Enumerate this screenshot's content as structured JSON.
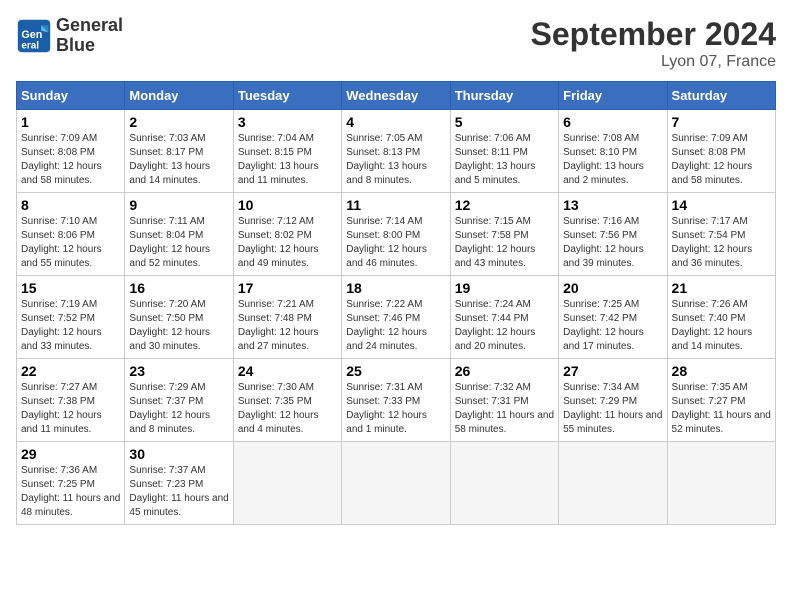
{
  "header": {
    "logo_text_line1": "General",
    "logo_text_line2": "Blue",
    "month_title": "September 2024",
    "location": "Lyon 07, France"
  },
  "weekdays": [
    "Sunday",
    "Monday",
    "Tuesday",
    "Wednesday",
    "Thursday",
    "Friday",
    "Saturday"
  ],
  "days": [
    {
      "num": "",
      "empty": true
    },
    {
      "num": "",
      "empty": true
    },
    {
      "num": "",
      "empty": true
    },
    {
      "num": "",
      "empty": true
    },
    {
      "num": "",
      "empty": true
    },
    {
      "num": "",
      "empty": true
    },
    {
      "num": "1",
      "sunrise": "7:09 AM",
      "sunset": "8:08 PM",
      "daylight": "12 hours and 58 minutes."
    },
    {
      "num": "2",
      "sunrise": "7:03 AM",
      "sunset": "8:17 PM",
      "daylight": "13 hours and 14 minutes."
    },
    {
      "num": "3",
      "sunrise": "7:04 AM",
      "sunset": "8:15 PM",
      "daylight": "13 hours and 11 minutes."
    },
    {
      "num": "4",
      "sunrise": "7:05 AM",
      "sunset": "8:13 PM",
      "daylight": "13 hours and 8 minutes."
    },
    {
      "num": "5",
      "sunrise": "7:06 AM",
      "sunset": "8:11 PM",
      "daylight": "13 hours and 5 minutes."
    },
    {
      "num": "6",
      "sunrise": "7:08 AM",
      "sunset": "8:10 PM",
      "daylight": "13 hours and 2 minutes."
    },
    {
      "num": "7",
      "sunrise": "7:09 AM",
      "sunset": "8:08 PM",
      "daylight": "12 hours and 58 minutes."
    },
    {
      "num": "8",
      "sunrise": "7:10 AM",
      "sunset": "8:06 PM",
      "daylight": "12 hours and 55 minutes."
    },
    {
      "num": "9",
      "sunrise": "7:11 AM",
      "sunset": "8:04 PM",
      "daylight": "12 hours and 52 minutes."
    },
    {
      "num": "10",
      "sunrise": "7:12 AM",
      "sunset": "8:02 PM",
      "daylight": "12 hours and 49 minutes."
    },
    {
      "num": "11",
      "sunrise": "7:14 AM",
      "sunset": "8:00 PM",
      "daylight": "12 hours and 46 minutes."
    },
    {
      "num": "12",
      "sunrise": "7:15 AM",
      "sunset": "7:58 PM",
      "daylight": "12 hours and 43 minutes."
    },
    {
      "num": "13",
      "sunrise": "7:16 AM",
      "sunset": "7:56 PM",
      "daylight": "12 hours and 39 minutes."
    },
    {
      "num": "14",
      "sunrise": "7:17 AM",
      "sunset": "7:54 PM",
      "daylight": "12 hours and 36 minutes."
    },
    {
      "num": "15",
      "sunrise": "7:19 AM",
      "sunset": "7:52 PM",
      "daylight": "12 hours and 33 minutes."
    },
    {
      "num": "16",
      "sunrise": "7:20 AM",
      "sunset": "7:50 PM",
      "daylight": "12 hours and 30 minutes."
    },
    {
      "num": "17",
      "sunrise": "7:21 AM",
      "sunset": "7:48 PM",
      "daylight": "12 hours and 27 minutes."
    },
    {
      "num": "18",
      "sunrise": "7:22 AM",
      "sunset": "7:46 PM",
      "daylight": "12 hours and 24 minutes."
    },
    {
      "num": "19",
      "sunrise": "7:24 AM",
      "sunset": "7:44 PM",
      "daylight": "12 hours and 20 minutes."
    },
    {
      "num": "20",
      "sunrise": "7:25 AM",
      "sunset": "7:42 PM",
      "daylight": "12 hours and 17 minutes."
    },
    {
      "num": "21",
      "sunrise": "7:26 AM",
      "sunset": "7:40 PM",
      "daylight": "12 hours and 14 minutes."
    },
    {
      "num": "22",
      "sunrise": "7:27 AM",
      "sunset": "7:38 PM",
      "daylight": "12 hours and 11 minutes."
    },
    {
      "num": "23",
      "sunrise": "7:29 AM",
      "sunset": "7:37 PM",
      "daylight": "12 hours and 8 minutes."
    },
    {
      "num": "24",
      "sunrise": "7:30 AM",
      "sunset": "7:35 PM",
      "daylight": "12 hours and 4 minutes."
    },
    {
      "num": "25",
      "sunrise": "7:31 AM",
      "sunset": "7:33 PM",
      "daylight": "12 hours and 1 minute."
    },
    {
      "num": "26",
      "sunrise": "7:32 AM",
      "sunset": "7:31 PM",
      "daylight": "11 hours and 58 minutes."
    },
    {
      "num": "27",
      "sunrise": "7:34 AM",
      "sunset": "7:29 PM",
      "daylight": "11 hours and 55 minutes."
    },
    {
      "num": "28",
      "sunrise": "7:35 AM",
      "sunset": "7:27 PM",
      "daylight": "11 hours and 52 minutes."
    },
    {
      "num": "29",
      "sunrise": "7:36 AM",
      "sunset": "7:25 PM",
      "daylight": "11 hours and 48 minutes."
    },
    {
      "num": "30",
      "sunrise": "7:37 AM",
      "sunset": "7:23 PM",
      "daylight": "11 hours and 45 minutes."
    },
    {
      "num": "",
      "empty": true
    },
    {
      "num": "",
      "empty": true
    },
    {
      "num": "",
      "empty": true
    },
    {
      "num": "",
      "empty": true
    },
    {
      "num": "",
      "empty": true
    }
  ],
  "labels": {
    "sunrise": "Sunrise:",
    "sunset": "Sunset:",
    "daylight": "Daylight hours"
  }
}
